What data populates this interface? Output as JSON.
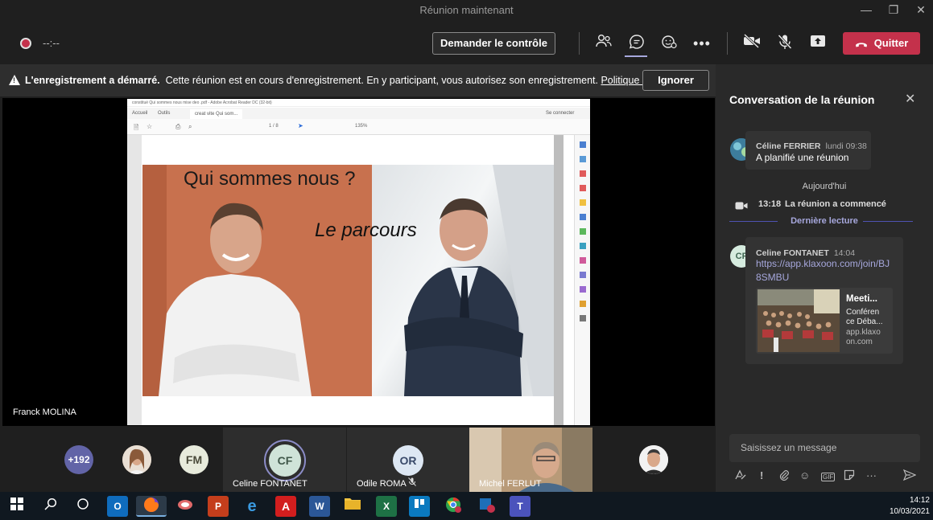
{
  "window": {
    "title": "Réunion maintenant"
  },
  "toolbar": {
    "timer": "--:--",
    "request_control": "Demander le contrôle",
    "leave": "Quitter"
  },
  "banner": {
    "bold": "L'enregistrement a démarré.",
    "text": "Cette réunion est en cours d'enregistrement. En y participant, vous autorisez son enregistrement.",
    "link": "Politique de ...",
    "dismiss": "Ignorer"
  },
  "pdf": {
    "window_title": "constitué Qui sommes nous mise deo .pdf - Adobe Acrobat Reader DC (32-bit)",
    "tab_home": "Accueil",
    "tab_tools": "Outils",
    "tab_doc": "creat vite Qui som...",
    "signin": "Se connecter",
    "zoom": "135%",
    "page": "1 / 8"
  },
  "slide": {
    "title": "Qui sommes nous ?",
    "subtitle": "Le parcours"
  },
  "presenter": {
    "name": "Franck MOLINA"
  },
  "participants": {
    "overflow": "+192",
    "fm": "FM",
    "tiles": [
      {
        "initials": "CF",
        "name": "Celine FONTANET"
      },
      {
        "initials": "OR",
        "name": "Odile ROMA"
      },
      {
        "name": "Michel FERLUT"
      }
    ]
  },
  "chat": {
    "title": "Conversation de la réunion",
    "messages": [
      {
        "author": "Céline FERRIER",
        "time": "lundi 09:38",
        "text": "A planifié une réunion"
      }
    ],
    "day_divider": "Aujourd'hui",
    "event_time": "13:18",
    "event_text": "La réunion a commencé",
    "last_read": "Dernière lecture",
    "link_message": {
      "avatar": "CF",
      "author": "Celine FONTANET",
      "time": "14:04",
      "url_line1": "https://app.klaxoon.com/join/BJ",
      "url_line2": "8SMBU",
      "preview_title": "Meeti...",
      "preview_desc_1": "Conféren",
      "preview_desc_2": "ce Déba...",
      "preview_domain_1": "app.klaxo",
      "preview_domain_2": "on.com"
    },
    "compose_placeholder": "Saisissez un message"
  },
  "taskbar": {
    "time": "14:12",
    "date": "10/03/2021"
  },
  "colors": {
    "leave_red": "#c4314b",
    "teams_purple": "#6264a7",
    "divider_purple": "#4f52b2"
  }
}
